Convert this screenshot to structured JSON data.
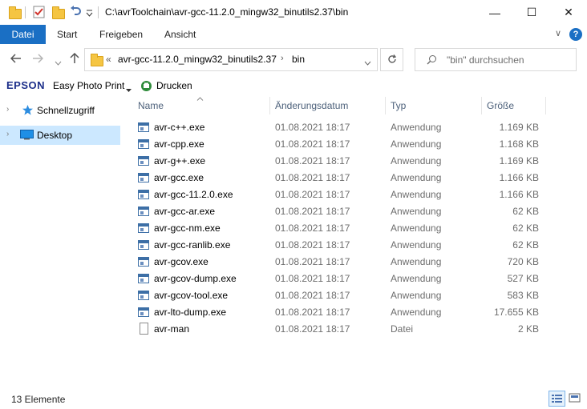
{
  "window": {
    "title": "C:\\avrToolchain\\avr-gcc-11.2.0_mingw32_binutils2.37\\bin",
    "minimize_label": "—",
    "maximize_label": "☐",
    "close_label": "✕"
  },
  "ribbon": {
    "tabs": [
      "Datei",
      "Start",
      "Freigeben",
      "Ansicht"
    ],
    "help": "?",
    "expand": "∨"
  },
  "nav": {
    "breadcrumb_overflow": "«",
    "path_segments": [
      "avr-gcc-11.2.0_mingw32_binutils2.37",
      "bin"
    ],
    "search_placeholder": "\"bin\" durchsuchen"
  },
  "epson": {
    "brand": "EPSON",
    "easy_photo_print": "Easy Photo Print",
    "print": "Drucken",
    "brand_color": "#1c2f8a"
  },
  "sidebar": {
    "items": [
      {
        "label": "Schnellzugriff",
        "icon": "star-icon"
      },
      {
        "label": "Desktop",
        "icon": "desktop-icon",
        "selected": true
      }
    ]
  },
  "columns": {
    "name": "Name",
    "date": "Änderungsdatum",
    "type": "Typ",
    "size": "Größe"
  },
  "files": [
    {
      "name": "avr-c++.exe",
      "date": "01.08.2021 18:17",
      "type": "Anwendung",
      "size": "1.169 KB",
      "icon": "exe-icon"
    },
    {
      "name": "avr-cpp.exe",
      "date": "01.08.2021 18:17",
      "type": "Anwendung",
      "size": "1.168 KB",
      "icon": "exe-icon"
    },
    {
      "name": "avr-g++.exe",
      "date": "01.08.2021 18:17",
      "type": "Anwendung",
      "size": "1.169 KB",
      "icon": "exe-icon"
    },
    {
      "name": "avr-gcc.exe",
      "date": "01.08.2021 18:17",
      "type": "Anwendung",
      "size": "1.166 KB",
      "icon": "exe-icon"
    },
    {
      "name": "avr-gcc-11.2.0.exe",
      "date": "01.08.2021 18:17",
      "type": "Anwendung",
      "size": "1.166 KB",
      "icon": "exe-icon"
    },
    {
      "name": "avr-gcc-ar.exe",
      "date": "01.08.2021 18:17",
      "type": "Anwendung",
      "size": "62 KB",
      "icon": "exe-icon"
    },
    {
      "name": "avr-gcc-nm.exe",
      "date": "01.08.2021 18:17",
      "type": "Anwendung",
      "size": "62 KB",
      "icon": "exe-icon"
    },
    {
      "name": "avr-gcc-ranlib.exe",
      "date": "01.08.2021 18:17",
      "type": "Anwendung",
      "size": "62 KB",
      "icon": "exe-icon"
    },
    {
      "name": "avr-gcov.exe",
      "date": "01.08.2021 18:17",
      "type": "Anwendung",
      "size": "720 KB",
      "icon": "exe-icon"
    },
    {
      "name": "avr-gcov-dump.exe",
      "date": "01.08.2021 18:17",
      "type": "Anwendung",
      "size": "527 KB",
      "icon": "exe-icon"
    },
    {
      "name": "avr-gcov-tool.exe",
      "date": "01.08.2021 18:17",
      "type": "Anwendung",
      "size": "583 KB",
      "icon": "exe-icon"
    },
    {
      "name": "avr-lto-dump.exe",
      "date": "01.08.2021 18:17",
      "type": "Anwendung",
      "size": "17.655 KB",
      "icon": "exe-icon"
    },
    {
      "name": "avr-man",
      "date": "01.08.2021 18:17",
      "type": "Datei",
      "size": "2 KB",
      "icon": "file-icon"
    }
  ],
  "status": {
    "item_count": "13 Elemente"
  },
  "colors": {
    "accent": "#1a6fc4",
    "selection": "#cce8ff",
    "header_text": "#4c607a"
  }
}
